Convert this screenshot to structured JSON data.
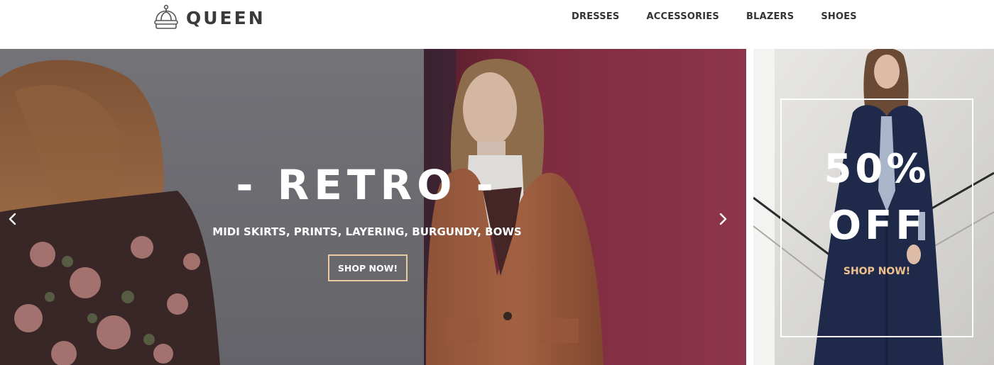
{
  "brand": {
    "name": "QUEEN",
    "icon": "crown-icon"
  },
  "nav": [
    {
      "label": "DRESSES"
    },
    {
      "label": "ACCESSORIES"
    },
    {
      "label": "BLAZERS"
    },
    {
      "label": "SHOES"
    }
  ],
  "hero": {
    "title": "- RETRO -",
    "subtitle": "MIDI SKIRTS, PRINTS, LAYERING, BURGUNDY, BOWS",
    "button_label": "SHOP NOW!",
    "prev_icon": "chevron-left-icon",
    "next_icon": "chevron-right-icon"
  },
  "promo": {
    "line1": "50%",
    "line2": "OFF",
    "button_label": "SHOP NOW!"
  },
  "colors": {
    "accent": "#e9c9a0",
    "promo_link": "#f0c08f",
    "text_dark": "#333333",
    "burgundy": "#8a2f45"
  }
}
